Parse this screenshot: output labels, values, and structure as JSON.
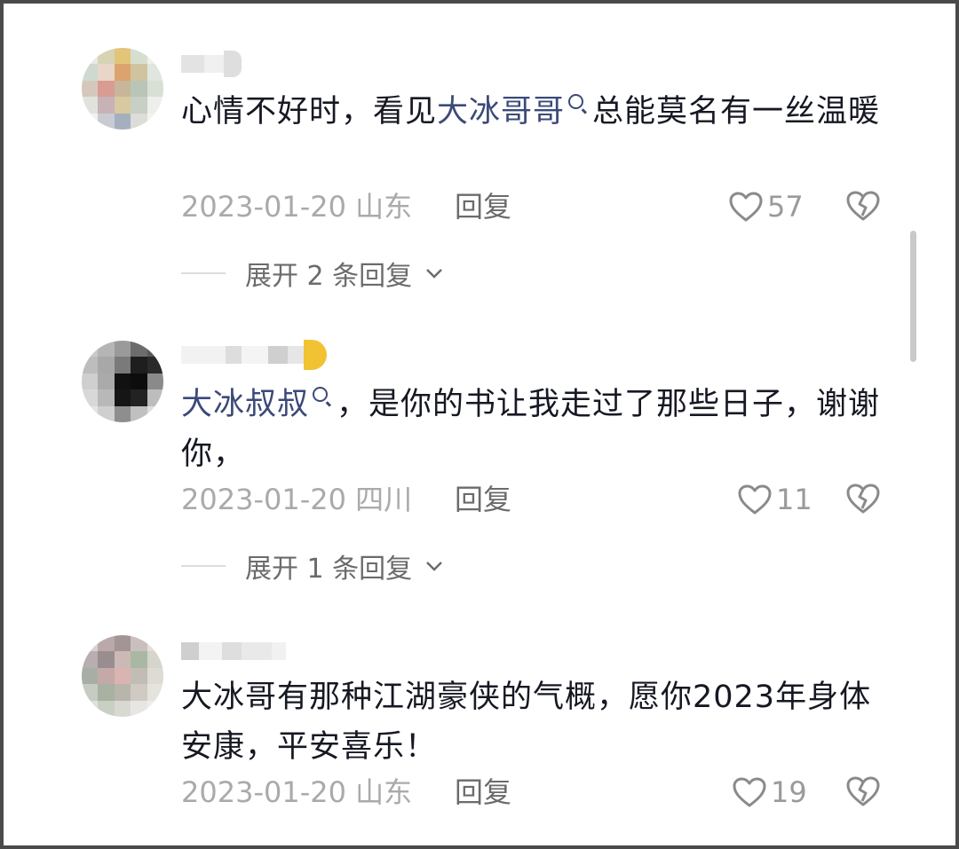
{
  "comments": [
    {
      "text_before": "心情不好时，看见",
      "mention": "大冰哥哥",
      "text_after": "总能莫名有一丝温暖",
      "date_location": "2023-01-20 山东",
      "reply_label": "回复",
      "likes": "57",
      "expand_label": "展开 2 条回复"
    },
    {
      "text_before": "",
      "mention": "大冰叔叔",
      "text_after": "，是你的书让我走过了那些日子，谢谢你，",
      "date_location": "2023-01-20 四川",
      "reply_label": "回复",
      "likes": "11",
      "expand_label": "展开 1 条回复"
    },
    {
      "text_before": "大冰哥有那种江湖豪侠的气概，愿你2023年身体安康，平安喜乐！",
      "mention": "",
      "text_after": "",
      "date_location": "2023-01-20 山东",
      "reply_label": "回复",
      "likes": "19",
      "expand_label": ""
    }
  ],
  "icons": {
    "like": "heart-outline-icon",
    "dislike": "broken-heart-icon",
    "mention_search": "search-icon",
    "expand": "chevron-down-icon"
  },
  "colors": {
    "mention": "#3b4a78",
    "text": "#161823",
    "meta": "#aaaaaa"
  }
}
